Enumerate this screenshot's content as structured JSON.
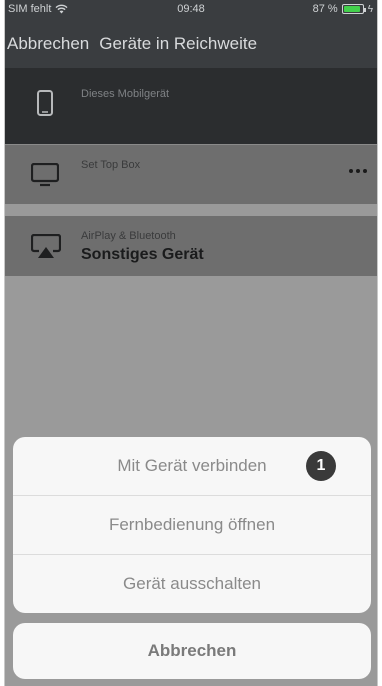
{
  "status_bar": {
    "carrier": "SIM fehlt",
    "time": "09:48",
    "battery": "87 %",
    "battery_level": 0.87,
    "battery_color": "#43d04c"
  },
  "navbar": {
    "cancel_label": "Abbrechen",
    "title": "Geräte in Reichweite"
  },
  "devices": [
    {
      "subtitle": "Dieses Mobilgerät",
      "name": "",
      "icon": "smartphone-icon"
    },
    {
      "subtitle": "Set Top Box",
      "name": "",
      "icon": "tv-icon",
      "more": "more-options-icon"
    },
    {
      "subtitle": "AirPlay & Bluetooth",
      "name": "Sonstiges Gerät",
      "icon": "airplay-icon"
    }
  ],
  "action_sheet": {
    "items": [
      {
        "label": "Mit Gerät verbinden",
        "badge": "1"
      },
      {
        "label": "Fernbedienung öffnen"
      },
      {
        "label": "Gerät ausschalten"
      }
    ],
    "cancel_label": "Abbrechen"
  }
}
